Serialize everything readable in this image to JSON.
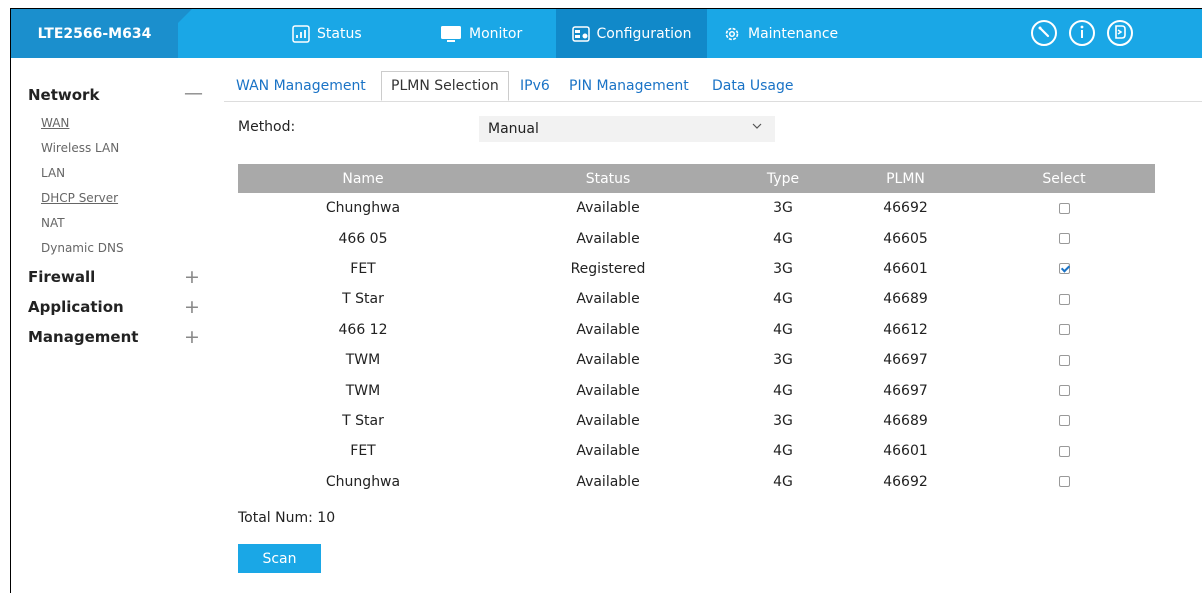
{
  "header": {
    "device_name": "LTE2566-M634",
    "nav": [
      {
        "label": "Status",
        "icon": "status-icon"
      },
      {
        "label": "Monitor",
        "icon": "monitor-icon"
      },
      {
        "label": "Configuration",
        "icon": "configuration-icon"
      },
      {
        "label": "Maintenance",
        "icon": "gear-icon"
      }
    ],
    "active_nav": "Configuration",
    "right_icons": [
      "wizard-icon",
      "info-icon",
      "logout-icon"
    ],
    "accent_color": "#1aa7e6"
  },
  "sidebar": {
    "sections": [
      {
        "label": "Network",
        "toggle": "—",
        "expanded": true,
        "items": [
          "WAN",
          "Wireless LAN",
          "LAN",
          "DHCP Server",
          "NAT",
          "Dynamic DNS"
        ]
      },
      {
        "label": "Firewall",
        "toggle": "+"
      },
      {
        "label": "Application",
        "toggle": "+"
      },
      {
        "label": "Management",
        "toggle": "+"
      }
    ]
  },
  "tabs": [
    "WAN Management",
    "PLMN Selection",
    "IPv6",
    "PIN Management",
    "Data Usage"
  ],
  "active_tab": "PLMN Selection",
  "method": {
    "label": "Method:",
    "value": "Manual"
  },
  "table": {
    "headers": [
      "Name",
      "Status",
      "Type",
      "PLMN",
      "Select"
    ],
    "rows": [
      {
        "name": "Chunghwa",
        "status": "Available",
        "type": "3G",
        "plmn": "46692",
        "selected": false
      },
      {
        "name": "466 05",
        "status": "Available",
        "type": "4G",
        "plmn": "46605",
        "selected": false
      },
      {
        "name": "FET",
        "status": "Registered",
        "type": "3G",
        "plmn": "46601",
        "selected": true
      },
      {
        "name": "T Star",
        "status": "Available",
        "type": "4G",
        "plmn": "46689",
        "selected": false
      },
      {
        "name": "466 12",
        "status": "Available",
        "type": "4G",
        "plmn": "46612",
        "selected": false
      },
      {
        "name": "TWM",
        "status": "Available",
        "type": "3G",
        "plmn": "46697",
        "selected": false
      },
      {
        "name": "TWM",
        "status": "Available",
        "type": "4G",
        "plmn": "46697",
        "selected": false
      },
      {
        "name": "T Star",
        "status": "Available",
        "type": "3G",
        "plmn": "46689",
        "selected": false
      },
      {
        "name": "FET",
        "status": "Available",
        "type": "4G",
        "plmn": "46601",
        "selected": false
      },
      {
        "name": "Chunghwa",
        "status": "Available",
        "type": "4G",
        "plmn": "46692",
        "selected": false
      }
    ]
  },
  "total_label": "Total Num: 10",
  "scan_label": "Scan"
}
